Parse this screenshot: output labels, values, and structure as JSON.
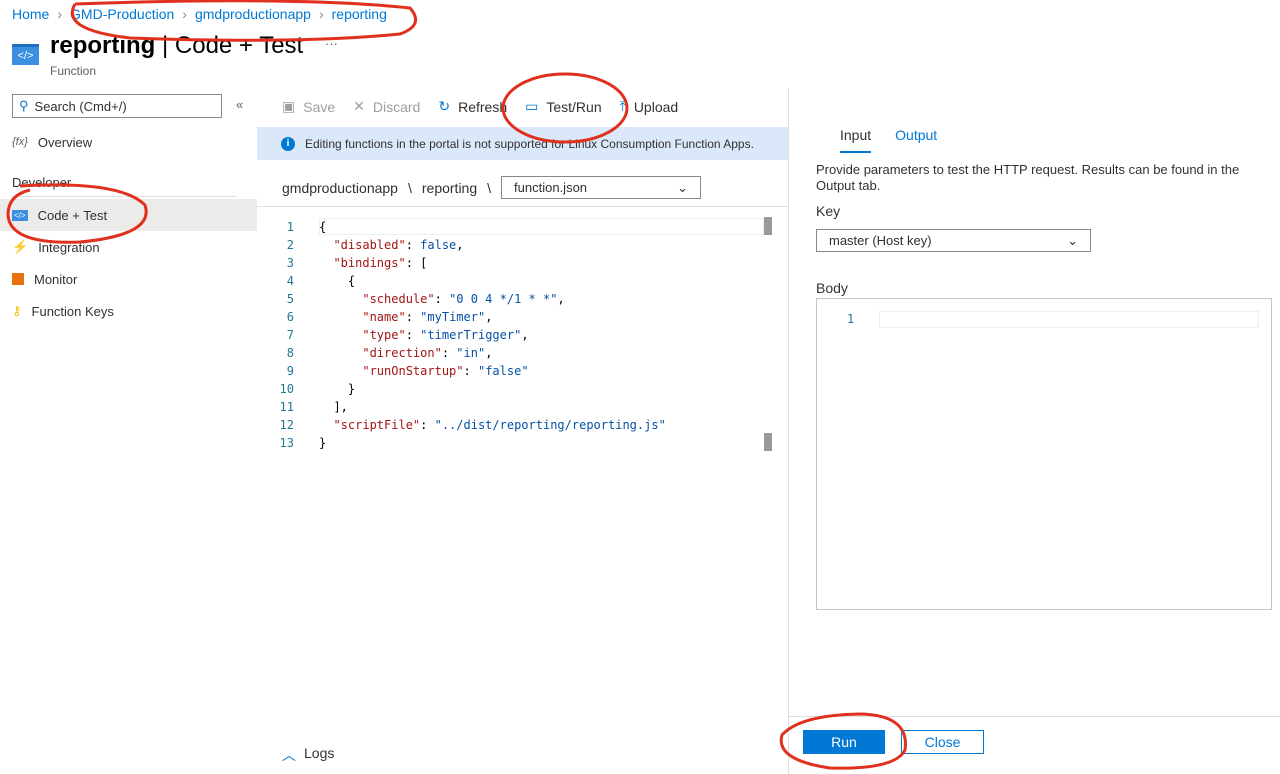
{
  "breadcrumb": [
    "Home",
    "GMD-Production",
    "gmdproductionapp",
    "reporting"
  ],
  "header": {
    "name": "reporting",
    "section": "Code + Test",
    "subtitle": "Function",
    "more": "···"
  },
  "sidebar": {
    "search_placeholder": "Search (Cmd+/)",
    "collapse": "«",
    "overview": "Overview",
    "group": "Developer",
    "items": [
      {
        "label": "Code + Test",
        "icon": "code-icon"
      },
      {
        "label": "Integration",
        "icon": "lightning-icon"
      },
      {
        "label": "Monitor",
        "icon": "monitor-icon"
      },
      {
        "label": "Function Keys",
        "icon": "key-icon"
      }
    ]
  },
  "toolbar": {
    "save": "Save",
    "discard": "Discard",
    "refresh": "Refresh",
    "testrun": "Test/Run",
    "upload": "Upload"
  },
  "info": "Editing functions in the portal is not supported for Linux Consumption Function Apps.",
  "path": {
    "app": "gmdproductionapp",
    "sep": "\\",
    "function": "reporting",
    "file": "function.json"
  },
  "code": [
    [
      [
        "p",
        "{"
      ]
    ],
    [
      [
        "p",
        "  "
      ],
      [
        "k",
        "\"disabled\""
      ],
      [
        "p",
        ": "
      ],
      [
        "v",
        "false"
      ],
      [
        "p",
        ","
      ]
    ],
    [
      [
        "p",
        "  "
      ],
      [
        "k",
        "\"bindings\""
      ],
      [
        "p",
        ": ["
      ]
    ],
    [
      [
        "p",
        "    {"
      ]
    ],
    [
      [
        "p",
        "      "
      ],
      [
        "k",
        "\"schedule\""
      ],
      [
        "p",
        ": "
      ],
      [
        "v",
        "\"0 0 4 */1 * *\""
      ],
      [
        "p",
        ","
      ]
    ],
    [
      [
        "p",
        "      "
      ],
      [
        "k",
        "\"name\""
      ],
      [
        "p",
        ": "
      ],
      [
        "v",
        "\"myTimer\""
      ],
      [
        "p",
        ","
      ]
    ],
    [
      [
        "p",
        "      "
      ],
      [
        "k",
        "\"type\""
      ],
      [
        "p",
        ": "
      ],
      [
        "v",
        "\"timerTrigger\""
      ],
      [
        "p",
        ","
      ]
    ],
    [
      [
        "p",
        "      "
      ],
      [
        "k",
        "\"direction\""
      ],
      [
        "p",
        ": "
      ],
      [
        "v",
        "\"in\""
      ],
      [
        "p",
        ","
      ]
    ],
    [
      [
        "p",
        "      "
      ],
      [
        "k",
        "\"runOnStartup\""
      ],
      [
        "p",
        ": "
      ],
      [
        "v",
        "\"false\""
      ]
    ],
    [
      [
        "p",
        "    }"
      ]
    ],
    [
      [
        "p",
        "  ],"
      ]
    ],
    [
      [
        "p",
        "  "
      ],
      [
        "k",
        "\"scriptFile\""
      ],
      [
        "p",
        ": "
      ],
      [
        "v",
        "\"../dist/reporting/reporting.js\""
      ]
    ],
    [
      [
        "p",
        "}"
      ]
    ]
  ],
  "logs": "Logs",
  "panel": {
    "tabs": [
      "Input",
      "Output"
    ],
    "description": "Provide parameters to test the HTTP request. Results can be found in the Output tab.",
    "key_label": "Key",
    "key_value": "master (Host key)",
    "body_label": "Body",
    "body_line": "1",
    "run": "Run",
    "close": "Close"
  }
}
